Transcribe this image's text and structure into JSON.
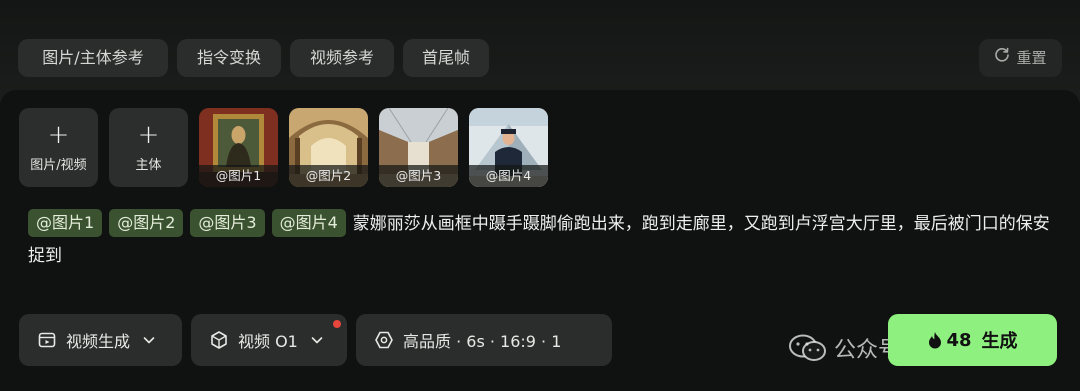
{
  "tabs": [
    {
      "label": "图片/主体参考"
    },
    {
      "label": "指令变换"
    },
    {
      "label": "视频参考"
    },
    {
      "label": "首尾帧"
    }
  ],
  "reset": {
    "label": "重置",
    "icon": "refresh-icon"
  },
  "uploads": [
    {
      "label": "图片/视频",
      "icon": "plus-icon"
    },
    {
      "label": "主体",
      "icon": "plus-icon"
    }
  ],
  "images": [
    {
      "caption": "@图片1"
    },
    {
      "caption": "@图片2"
    },
    {
      "caption": "@图片3"
    },
    {
      "caption": "@图片4"
    }
  ],
  "prompt": {
    "mentions": [
      "@图片1",
      "@图片2",
      "@图片3",
      "@图片4"
    ],
    "text": "蒙娜丽莎从画框中蹑手蹑脚偷跑出来，跑到走廊里，又跑到卢浮宫大厅里，最后被门口的保安捉到"
  },
  "controls": {
    "mode": {
      "label": "视频生成",
      "icon": "video-generate-icon"
    },
    "model": {
      "label": "视频 O1",
      "icon": "model-cube-icon"
    },
    "settings": {
      "label": "高品质 · 6s · 16:9 · 1",
      "icon": "quality-hex-icon"
    }
  },
  "watermark": {
    "text": "公众号 · 量子位",
    "icon": "wechat-icon"
  },
  "generate": {
    "cost": "48",
    "label": "生成",
    "icon": "flame-icon"
  },
  "colors": {
    "accent": "#8ef07f",
    "chip": "#3a5230",
    "notify_dot": "#e8453c"
  }
}
